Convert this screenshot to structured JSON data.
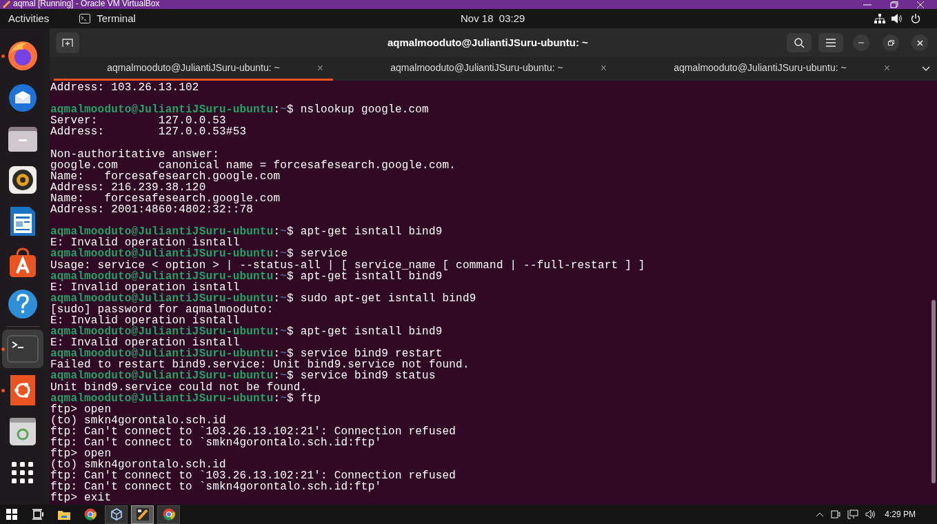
{
  "vm_window": {
    "title": "aqmal [Running] - Oracle VM VirtualBox"
  },
  "top_bar": {
    "activities": "Activities",
    "app_menu": "Terminal",
    "clock": "Nov 18  03:29"
  },
  "dock": {
    "items": [
      {
        "kind": "firefox",
        "running": true,
        "selected": false
      },
      {
        "kind": "mail",
        "running": false,
        "selected": false
      },
      {
        "kind": "files",
        "running": false,
        "selected": false
      },
      {
        "kind": "music",
        "running": false,
        "selected": false
      },
      {
        "kind": "writer",
        "running": false,
        "selected": false
      },
      {
        "kind": "store",
        "running": false,
        "selected": false
      },
      {
        "kind": "help",
        "running": false,
        "selected": false
      },
      {
        "kind": "terminal",
        "running": true,
        "selected": true
      },
      {
        "kind": "ubuntu",
        "running": true,
        "selected": false
      },
      {
        "kind": "trash",
        "running": false,
        "selected": false
      },
      {
        "kind": "grid",
        "running": false,
        "selected": false
      }
    ]
  },
  "terminal": {
    "title": "aqmalmooduto@JuliantiJSuru-ubuntu: ~",
    "tabs": [
      {
        "label": "aqmalmooduto@JuliantiJSuru-ubuntu: ~",
        "close": "×",
        "selected": true
      },
      {
        "label": "aqmalmooduto@JuliantiJSuru-ubuntu: ~",
        "close": "×",
        "selected": false
      },
      {
        "label": "aqmalmooduto@JuliantiJSuru-ubuntu: ~",
        "close": "×",
        "selected": false
      }
    ],
    "lines": [
      {
        "kind": "output",
        "text": "Address: 103.26.13.102"
      },
      {
        "kind": "blank"
      },
      {
        "kind": "prompt",
        "user": "aqmalmooduto@JuliantiJSuru-ubuntu",
        "sep": ":",
        "path": "~",
        "command": "$ nslookup google.com"
      },
      {
        "kind": "output",
        "text": "Server:\t\t127.0.0.53"
      },
      {
        "kind": "output",
        "text": "Address:\t127.0.0.53#53"
      },
      {
        "kind": "blank"
      },
      {
        "kind": "output",
        "text": "Non-authoritative answer:"
      },
      {
        "kind": "output",
        "text": "google.com\tcanonical name = forcesafesearch.google.com."
      },
      {
        "kind": "output",
        "text": "Name:\tforcesafesearch.google.com"
      },
      {
        "kind": "output",
        "text": "Address: 216.239.38.120"
      },
      {
        "kind": "output",
        "text": "Name:\tforcesafesearch.google.com"
      },
      {
        "kind": "output",
        "text": "Address: 2001:4860:4802:32::78"
      },
      {
        "kind": "blank"
      },
      {
        "kind": "prompt",
        "user": "aqmalmooduto@JuliantiJSuru-ubuntu",
        "sep": ":",
        "path": "~",
        "command": "$ apt-get isntall bind9"
      },
      {
        "kind": "output",
        "text": "E: Invalid operation isntall"
      },
      {
        "kind": "prompt",
        "user": "aqmalmooduto@JuliantiJSuru-ubuntu",
        "sep": ":",
        "path": "~",
        "command": "$ service"
      },
      {
        "kind": "output",
        "text": "Usage: service < option > | --status-all | [ service_name [ command | --full-restart ] ]"
      },
      {
        "kind": "prompt",
        "user": "aqmalmooduto@JuliantiJSuru-ubuntu",
        "sep": ":",
        "path": "~",
        "command": "$ apt-get isntall bind9"
      },
      {
        "kind": "output",
        "text": "E: Invalid operation isntall"
      },
      {
        "kind": "prompt",
        "user": "aqmalmooduto@JuliantiJSuru-ubuntu",
        "sep": ":",
        "path": "~",
        "command": "$ sudo apt-get isntall bind9"
      },
      {
        "kind": "output",
        "text": "[sudo] password for aqmalmooduto:"
      },
      {
        "kind": "output",
        "text": "E: Invalid operation isntall"
      },
      {
        "kind": "prompt",
        "user": "aqmalmooduto@JuliantiJSuru-ubuntu",
        "sep": ":",
        "path": "~",
        "command": "$ apt-get isntall bind9"
      },
      {
        "kind": "output",
        "text": "E: Invalid operation isntall"
      },
      {
        "kind": "prompt",
        "user": "aqmalmooduto@JuliantiJSuru-ubuntu",
        "sep": ":",
        "path": "~",
        "command": "$ service bind9 restart"
      },
      {
        "kind": "output",
        "text": "Failed to restart bind9.service: Unit bind9.service not found."
      },
      {
        "kind": "prompt",
        "user": "aqmalmooduto@JuliantiJSuru-ubuntu",
        "sep": ":",
        "path": "~",
        "command": "$ service bind9 status"
      },
      {
        "kind": "output",
        "text": "Unit bind9.service could not be found."
      },
      {
        "kind": "prompt",
        "user": "aqmalmooduto@JuliantiJSuru-ubuntu",
        "sep": ":",
        "path": "~",
        "command": "$ ftp"
      },
      {
        "kind": "output",
        "text": "ftp> open"
      },
      {
        "kind": "output",
        "text": "(to) smkn4gorontalo.sch.id"
      },
      {
        "kind": "output",
        "text": "ftp: Can't connect to `103.26.13.102:21': Connection refused"
      },
      {
        "kind": "output",
        "text": "ftp: Can't connect to `smkn4gorontalo.sch.id:ftp'"
      },
      {
        "kind": "output",
        "text": "ftp> open"
      },
      {
        "kind": "output",
        "text": "(to) smkn4gorontalo.sch.id"
      },
      {
        "kind": "output",
        "text": "ftp: Can't connect to `103.26.13.102:21': Connection refused"
      },
      {
        "kind": "output",
        "text": "ftp: Can't connect to `smkn4gorontalo.sch.id:ftp'"
      },
      {
        "kind": "output",
        "text": "ftp> exit"
      }
    ]
  },
  "taskbar": {
    "items": [
      {
        "kind": "start",
        "selected": false
      },
      {
        "kind": "taskview",
        "selected": false
      },
      {
        "kind": "folder",
        "selected": false
      },
      {
        "kind": "browser",
        "selected": false
      },
      {
        "kind": "vbox",
        "selected": false
      },
      {
        "kind": "sketch",
        "selected": true
      },
      {
        "kind": "browser",
        "selected": false
      }
    ],
    "clock": "4:29 PM"
  }
}
